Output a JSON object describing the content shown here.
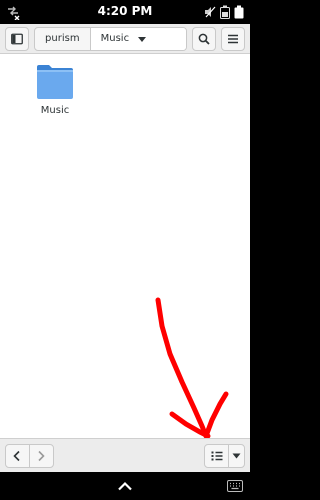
{
  "status_bar": {
    "time": "4:20 PM",
    "icons": [
      "network-disconnected-icon",
      "volume-muted-icon",
      "battery-icon",
      "battery-full-icon"
    ]
  },
  "header": {
    "sidebar_icon": "sidebar-toggle-icon",
    "path": [
      "purism",
      "Music"
    ],
    "search_icon": "search-icon",
    "menu_icon": "hamburger-menu-icon"
  },
  "files": [
    {
      "name": "Music",
      "icon": "folder-icon"
    }
  ],
  "annotation": {
    "color": "#ff0000",
    "shape": "hand-drawn-arrow"
  },
  "footer": {
    "back_icon": "chevron-left-icon",
    "forward_icon": "chevron-right-icon",
    "view_icon": "list-view-icon",
    "view_menu_icon": "chevron-down-icon"
  },
  "osk": {
    "show_icon": "chevron-up-icon",
    "keyboard_icon": "keyboard-icon"
  }
}
